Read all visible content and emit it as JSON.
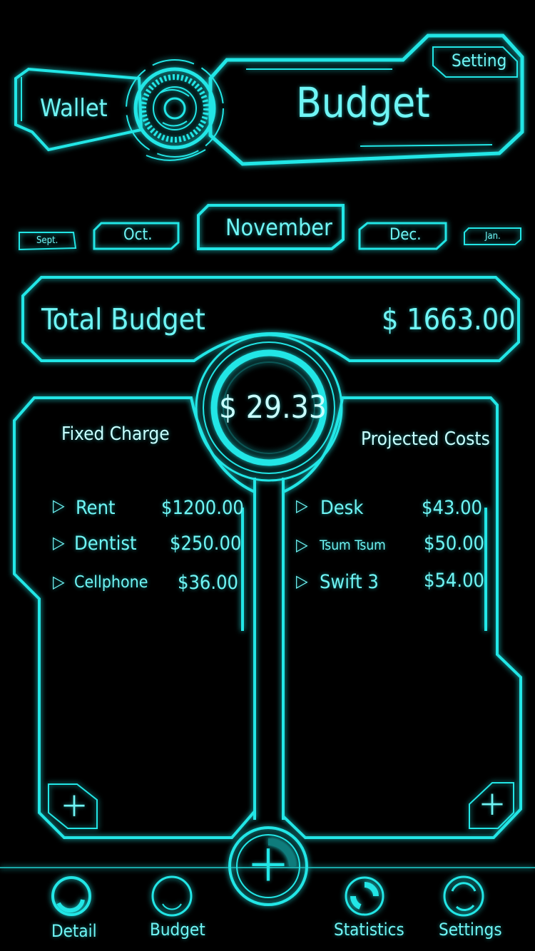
{
  "header": {
    "wallet_label": "Wallet",
    "title": "Budget",
    "setting_label": "Setting"
  },
  "months": {
    "far_prev": "Sept.",
    "prev": "Oct.",
    "current": "November",
    "next": "Dec.",
    "far_next": "Jan."
  },
  "total": {
    "label": "Total Budget",
    "amount": "$ 1663.00"
  },
  "remaining": "$ 29.33",
  "fixed": {
    "title": "Fixed Charge",
    "items": [
      {
        "name": "Rent",
        "amount": "$1200.00"
      },
      {
        "name": "Dentist",
        "amount": "$250.00"
      },
      {
        "name": "Cellphone",
        "amount": "$36.00"
      }
    ]
  },
  "projected": {
    "title": "Projected Costs",
    "items": [
      {
        "name": "Desk",
        "amount": "$43.00"
      },
      {
        "name": "Tsum Tsum",
        "amount": "$50.00"
      },
      {
        "name": "Swift 3",
        "amount": "$54.00"
      }
    ]
  },
  "tabs": [
    {
      "label": "Detail",
      "icon": "detail-ring-icon"
    },
    {
      "label": "Budget",
      "icon": "budget-ring-icon"
    },
    {
      "label": "Statistics",
      "icon": "statistics-ring-icon"
    },
    {
      "label": "Settings",
      "icon": "settings-ring-icon"
    }
  ],
  "colors": {
    "accent": "#22e6e6",
    "text": "#6ff5f5",
    "background": "#000000"
  }
}
